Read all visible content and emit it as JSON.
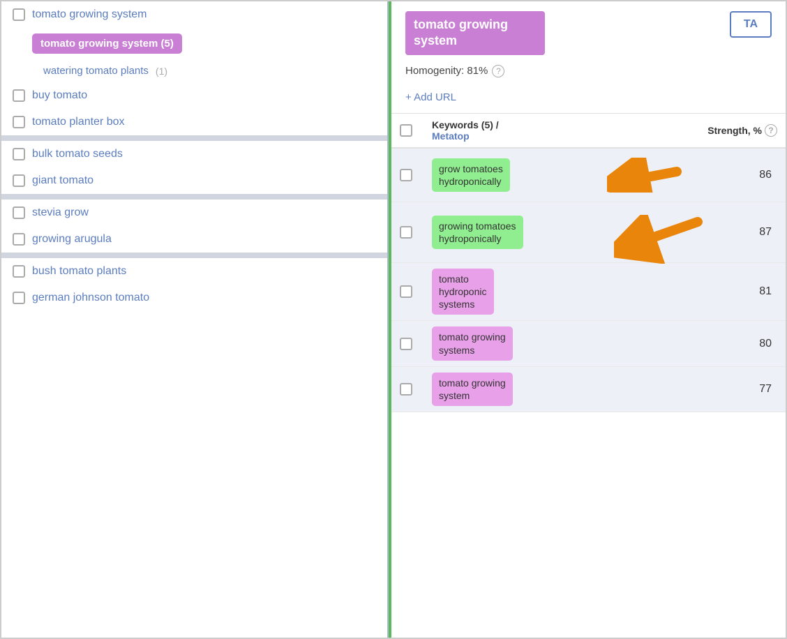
{
  "left": {
    "items": [
      {
        "id": "tomato-growing-system-top",
        "label": "tomato growing system",
        "hasCheckbox": true,
        "type": "top-item"
      },
      {
        "id": "tomato-growing-system-active",
        "label": "tomato growing system",
        "count": "(5)",
        "type": "active-pill"
      },
      {
        "id": "watering-tomato-plants",
        "label": "watering tomato plants",
        "count": "(1)",
        "type": "sub-item"
      },
      {
        "id": "buy-tomato",
        "label": "buy tomato",
        "hasCheckbox": true,
        "type": "item"
      },
      {
        "id": "tomato-planter-box",
        "label": "tomato planter box",
        "hasCheckbox": true,
        "type": "item"
      },
      {
        "id": "separator1",
        "type": "separator"
      },
      {
        "id": "bulk-tomato-seeds",
        "label": "bulk tomato seeds",
        "hasCheckbox": true,
        "type": "item"
      },
      {
        "id": "giant-tomato",
        "label": "giant tomato",
        "hasCheckbox": true,
        "type": "item"
      },
      {
        "id": "separator2",
        "type": "separator"
      },
      {
        "id": "stevia-grow",
        "label": "stevia grow",
        "hasCheckbox": true,
        "type": "item"
      },
      {
        "id": "growing-arugula",
        "label": "growing arugula",
        "hasCheckbox": true,
        "type": "item"
      },
      {
        "id": "separator3",
        "type": "separator"
      },
      {
        "id": "bush-tomato-plants",
        "label": "bush tomato plants",
        "hasCheckbox": true,
        "type": "item"
      },
      {
        "id": "german-johnson-tomato",
        "label": "german johnson tomato",
        "hasCheckbox": true,
        "type": "item"
      }
    ]
  },
  "right": {
    "title": "tomato growing system",
    "homogeneity_label": "Homogenity: 81%",
    "ta_button": "TA",
    "add_url": "+ Add URL",
    "help_icon": "?",
    "table": {
      "col_keywords": "Keywords (5) /",
      "col_metatop": "Metatop",
      "col_strength": "Strength, %",
      "rows": [
        {
          "keyword": "grow tomatoes hydroponically",
          "strength": 86,
          "color": "green"
        },
        {
          "keyword": "growing tomatoes hydroponically",
          "strength": 87,
          "color": "green"
        },
        {
          "keyword": "tomato hydroponic systems",
          "strength": 81,
          "color": "pink"
        },
        {
          "keyword": "tomato growing systems",
          "strength": 80,
          "color": "pink"
        },
        {
          "keyword": "tomato growing system",
          "strength": 77,
          "color": "pink"
        }
      ]
    }
  }
}
